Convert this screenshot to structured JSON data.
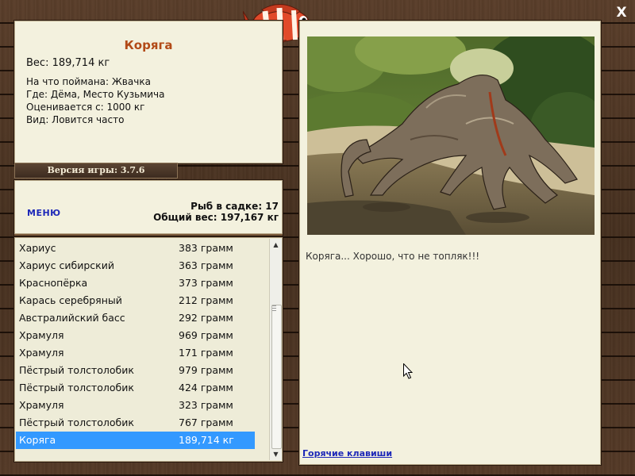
{
  "close_label": "X",
  "info": {
    "title": "Коряга",
    "weight": "Вес: 189,714 кг",
    "caught_with": "На что поймана: Жвачка",
    "location": "Где: Дёма, Место Кузьмича",
    "valued_from": "Оценивается с: 1000 кг",
    "kind": "Вид: Ловится часто"
  },
  "version": "Версия игры: 3.7.6",
  "summary": {
    "menu_label": "МЕНЮ",
    "fish_count": "Рыб в садке: 17",
    "total_weight": "Общий вес: 197,167 кг"
  },
  "catch_list": [
    {
      "name": "Хариус",
      "weight": "383 грамм"
    },
    {
      "name": "Хариус сибирский",
      "weight": "363 грамм"
    },
    {
      "name": "Краснопёрка",
      "weight": "373 грамм"
    },
    {
      "name": "Карась серебряный",
      "weight": "212 грамм"
    },
    {
      "name": "Австралийский басс",
      "weight": "292 грамм"
    },
    {
      "name": "Храмуля",
      "weight": "969 грамм"
    },
    {
      "name": "Храмуля",
      "weight": "171 грамм"
    },
    {
      "name": "Пёстрый толстолобик",
      "weight": "979 грамм"
    },
    {
      "name": "Пёстрый толстолобик",
      "weight": "424 грамм"
    },
    {
      "name": "Храмуля",
      "weight": "323 грамм"
    },
    {
      "name": "Пёстрый толстолобик",
      "weight": "767 грамм"
    },
    {
      "name": "Коряга",
      "weight": "189,714 кг",
      "selected": true
    }
  ],
  "scrollbar": {
    "position_fraction": 1.0
  },
  "detail": {
    "caption": "Коряга... Хорошо, что не топляк!!!",
    "hotkeys_label": "Горячие клавиши"
  },
  "colors": {
    "title": "#b24a17",
    "link": "#1d28b8",
    "selection": "#3399ff",
    "panel": "#f3f1de"
  },
  "icons": [
    "fish-logo-icon",
    "close-icon",
    "scroll-up-icon",
    "scroll-down-icon",
    "mouse-cursor-icon"
  ]
}
